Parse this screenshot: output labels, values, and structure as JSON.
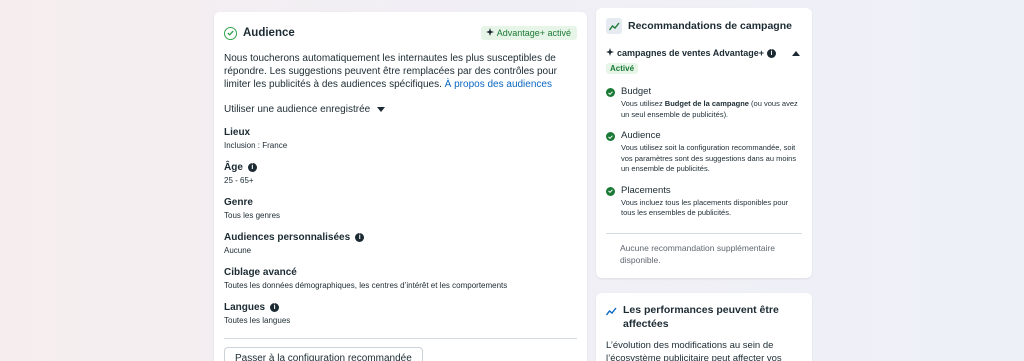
{
  "audience": {
    "title": "Audience",
    "badge": "Advantage+ activé",
    "description": "Nous toucherons automatiquement les internautes les plus susceptibles de répondre. Les suggestions peuvent être remplacées par des contrôles pour limiter les publicités à des audiences spécifiques.",
    "about_link": "À propos des audiences",
    "saved_audience_label": "Utiliser une audience enregistrée",
    "fields": [
      {
        "label": "Lieux",
        "value": "Inclusion : France",
        "info": false
      },
      {
        "label": "Âge",
        "value": "25 - 65+",
        "info": true
      },
      {
        "label": "Genre",
        "value": "Tous les genres",
        "info": false
      },
      {
        "label": "Audiences personnalisées",
        "value": "Aucune",
        "info": true
      },
      {
        "label": "Ciblage avancé",
        "value": "Toutes les données démographiques, les centres d’intérêt et les comportements",
        "info": false
      },
      {
        "label": "Langues",
        "value": "Toutes les langues",
        "info": true
      }
    ],
    "recommended_button": "Passer à la configuration recommandée"
  },
  "recommendations": {
    "title": "Recommandations de campagne",
    "section_title": "campagnes de ventes Advantage+",
    "section_badge": "Activé",
    "items": [
      {
        "title": "Budget",
        "text_before": "Vous utilisez ",
        "text_bold": "Budget de la campagne",
        "text_after": " (ou vous avez un seul ensemble de publicités)."
      },
      {
        "title": "Audience",
        "text": "Vous utilisez soit la configuration recommandée, soit vos paramètres sont des suggestions dans au moins un ensemble de publicités."
      },
      {
        "title": "Placements",
        "text": "Vous incluez tous les placements disponibles pour tous les ensembles de publicités."
      }
    ],
    "no_more": "Aucune recommandation supplémentaire disponible."
  },
  "performance": {
    "title": "Les performances peuvent être affectées",
    "text": "L’évolution des modifications au sein de l’écosystème publicitaire peut affecter vos"
  },
  "colors": {
    "accent_green": "#1a7a35",
    "link_blue": "#0a66c2"
  }
}
